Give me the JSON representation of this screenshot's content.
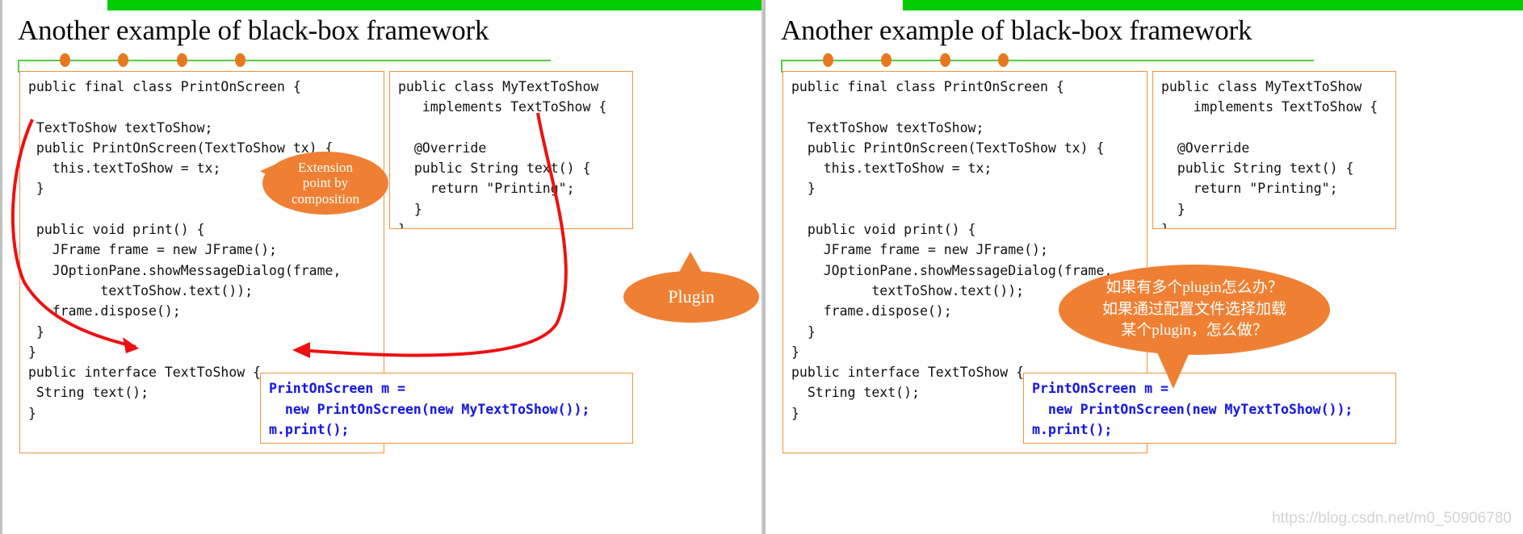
{
  "slides": [
    {
      "title": "Another example of black-box framework",
      "accent_green": "#00cc00",
      "accent_orange": "#e8781e",
      "code_main": "public final class PrintOnScreen {\n\n TextToShow textToShow;\n public PrintOnScreen(TextToShow tx) {\n   this.textToShow = tx;\n }\n\n public void print() {\n   JFrame frame = new JFrame();\n   JOptionPane.showMessageDialog(frame,\n         textToShow.text());\n   frame.dispose();\n }\n}\npublic interface TextToShow {\n String text();\n}",
      "code_impl": "public class MyTextToShow\n   implements TextToShow {\n\n  @Override\n  public String text() {\n    return \"Printing\";\n  }\n}",
      "code_usage": "PrintOnScreen m =\n  new PrintOnScreen(new MyTextToShow());\nm.print();",
      "bubbles": [
        {
          "id": "extension-point",
          "lines": [
            "Extension",
            "point by",
            "composition"
          ]
        },
        {
          "id": "plugin",
          "lines": [
            "Plugin"
          ]
        }
      ]
    },
    {
      "title": "Another example of black-box framework",
      "accent_green": "#00cc00",
      "accent_orange": "#e8781e",
      "code_main": "public final class PrintOnScreen {\n\n  TextToShow textToShow;\n  public PrintOnScreen(TextToShow tx) {\n    this.textToShow = tx;\n  }\n\n  public void print() {\n    JFrame frame = new JFrame();\n    JOptionPane.showMessageDialog(frame,\n          textToShow.text());\n    frame.dispose();\n  }\n}\npublic interface TextToShow {\n  String text();\n}",
      "code_impl": "public class MyTextToShow\n    implements TextToShow {\n\n  @Override\n  public String text() {\n    return \"Printing\";\n  }\n}",
      "code_usage": "PrintOnScreen m =\n  new PrintOnScreen(new MyTextToShow());\nm.print();",
      "bubbles": [
        {
          "id": "question",
          "lines": [
            "如果有多个plugin怎么办？",
            "如果通过配置文件选择加载",
            "某个plugin，怎么做？"
          ]
        }
      ]
    }
  ],
  "watermark": "https://blog.csdn.net/m0_50906780"
}
